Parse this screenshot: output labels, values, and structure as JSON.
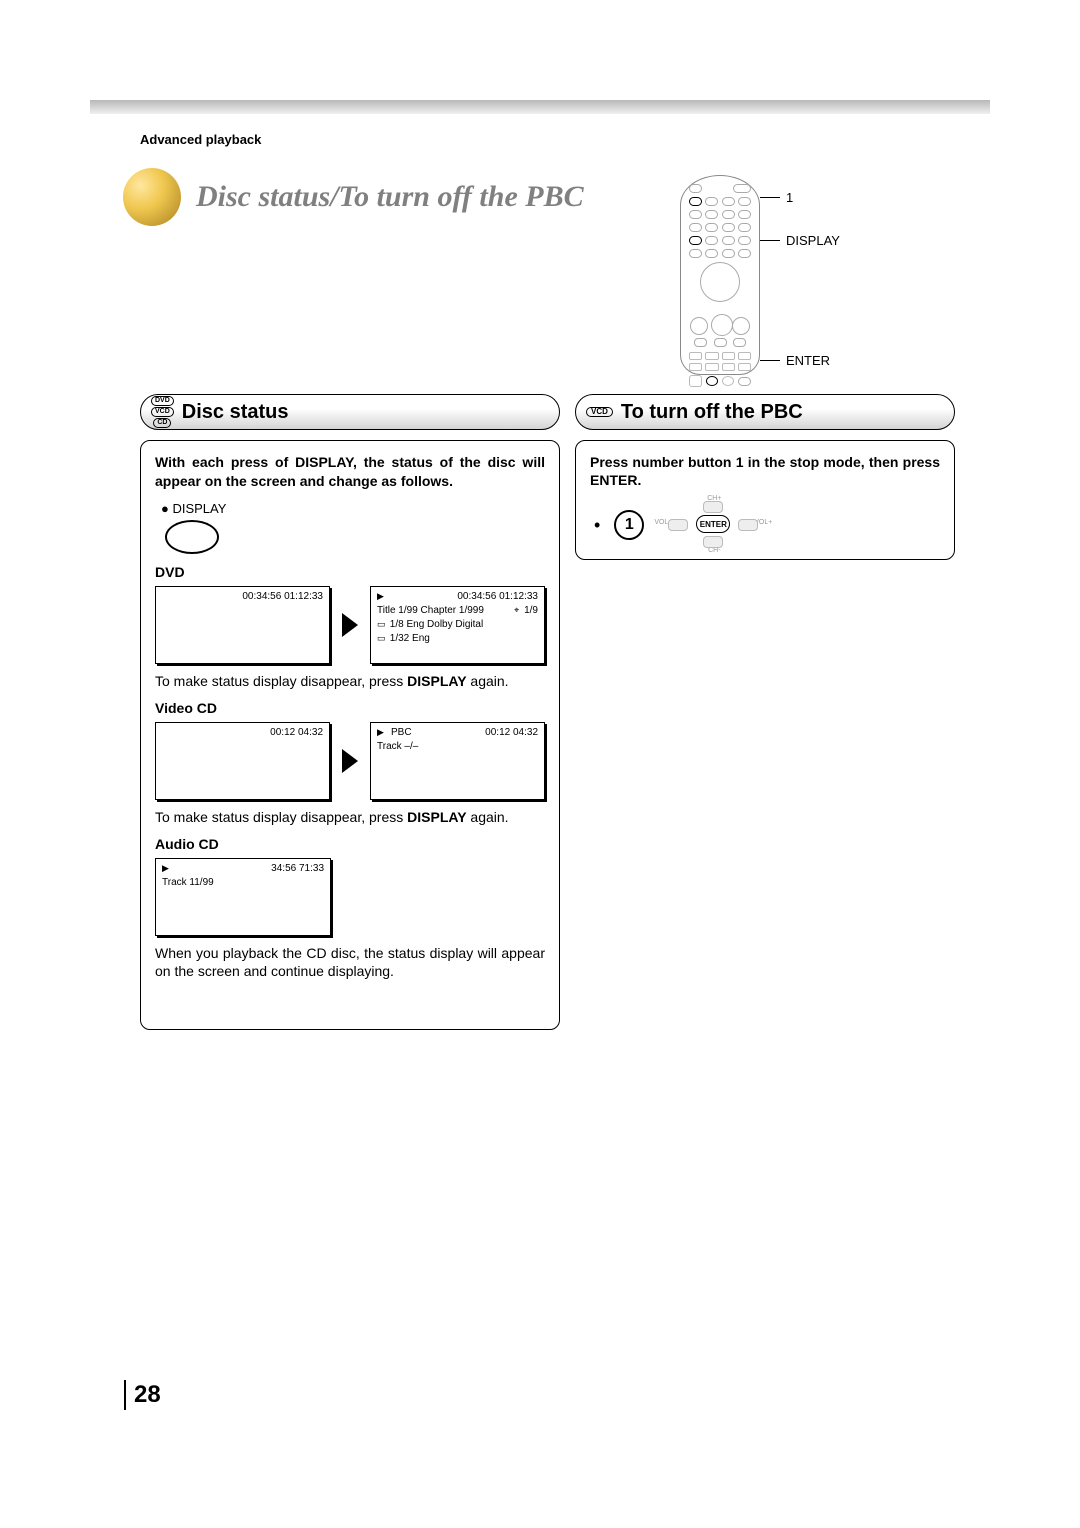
{
  "header": {
    "section_label": "Advanced playback",
    "page_title": "Disc status/To turn off the PBC"
  },
  "remote_callouts": {
    "one": "1",
    "display": "DISPLAY",
    "enter": "ENTER"
  },
  "left_section": {
    "badges": [
      "DVD",
      "VCD",
      "CD"
    ],
    "heading": "Disc status",
    "intro": "With each press of DISPLAY, the status of the disc will appear on the screen and change as follows.",
    "display_label": "DISPLAY",
    "dvd": {
      "label": "DVD",
      "shot1_times": "00:34:56  01:12:33",
      "shot2_times": "00:34:56  01:12:33",
      "shot2_l2_left": "Title      1/99   Chapter  1/999",
      "shot2_l2_right": "1/9",
      "shot2_l3": "1/8   Eng Dolby Digital",
      "shot2_l4": "1/32   Eng",
      "note_pre": "To make status display disappear, press ",
      "note_bold": "DISPLAY",
      "note_post": " again."
    },
    "vcd": {
      "label": "Video CD",
      "shot1_times": "00:12      04:32",
      "shot2_top": "PBC",
      "shot2_times": "00:12      04:32",
      "shot2_l2": "Track    –/–",
      "note_pre": "To make status display disappear, press ",
      "note_bold": "DISPLAY",
      "note_post": " again."
    },
    "audiocd": {
      "label": "Audio CD",
      "shot_times": "34:56      71:33",
      "shot_l2": "Track 11/99",
      "note": "When you playback the CD disc, the status display will appear on the screen and continue displaying."
    }
  },
  "right_section": {
    "badge": "VCD",
    "heading": "To turn off the PBC",
    "intro": "Press number button 1 in the stop mode, then press ENTER.",
    "num": "1",
    "dpad": {
      "up": "CH+",
      "down": "CH-",
      "left": "VOL-",
      "right": "VOL+",
      "center": "ENTER"
    }
  },
  "page_number": "28"
}
